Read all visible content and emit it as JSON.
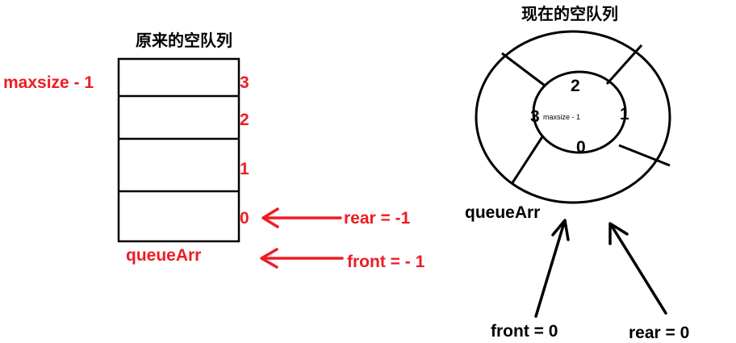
{
  "left": {
    "title": "原来的空队列",
    "maxsize_label": "maxsize - 1",
    "indices": [
      "3",
      "2",
      "1",
      "0"
    ],
    "array_label": "queueArr",
    "rear_label": "rear = -1",
    "front_label": "front = - 1"
  },
  "right": {
    "title": "现在的空队列",
    "ring_indices": {
      "top": "2",
      "left": "3",
      "right": "1",
      "bottom": "0"
    },
    "maxsize_small": "maxsize - 1",
    "array_label": "queueArr",
    "front_label": "front = 0",
    "rear_label": "rear = 0"
  },
  "colors": {
    "accent_red": "#ee1c24",
    "line": "#000000"
  }
}
